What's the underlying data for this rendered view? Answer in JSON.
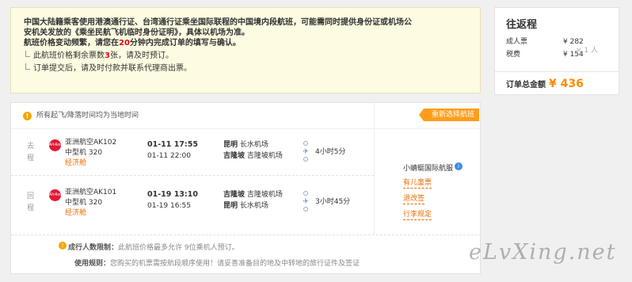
{
  "notice": {
    "line1": "中国大陆籍乘客使用港澳通行证、台湾通行证乘坐国际联程的中国境内段航班，可能需同时提供身份证或机场公",
    "line2": "安机关发放的《乘坐民航飞机临时身份证明》，具体以机场为准。",
    "line3_pre": "航班价格变动频繁，请您在",
    "line3_num": "20",
    "line3_post": "分钟内完成订单的填写与确认。",
    "item1_pre": "此航班价格剩余票数",
    "item1_num": "3",
    "item1_post": "张，请及时预订。",
    "item2": "订单提交后，请及时付款并联系代理商出票。"
  },
  "summary": {
    "title": "往返程",
    "adult_label": "成人票",
    "adult_price": "¥ 282",
    "tax_label": "税费",
    "tax_price": "¥ 154",
    "multiplier": "× 1 人",
    "total_label": "订单总金额",
    "total_price": "¥ 436"
  },
  "flight": {
    "header": "所有起飞/降落时间均为当地时间",
    "legs": [
      {
        "dir": "去程",
        "logo": "AirAsia",
        "airline": "亚洲航空AK102",
        "aircraft": "中型机 320",
        "cabin": "经济舱",
        "dep_time": "01-11 17:55",
        "arr_time": "01-11 22:00",
        "dep_city": "昆明",
        "dep_airport": "长水机场",
        "arr_city": "吉隆坡",
        "arr_airport": "吉隆坡机场",
        "duration": "4小时5分"
      },
      {
        "dir": "回程",
        "logo": "AirAsia",
        "airline": "亚洲航空AK101",
        "aircraft": "中型机 320",
        "cabin": "经济舱",
        "dep_time": "01-19 13:10",
        "arr_time": "01-19 16:55",
        "dep_city": "吉隆坡",
        "dep_airport": "吉隆坡机场",
        "arr_city": "昆明",
        "arr_airport": "长水机场",
        "duration": "3小时45分"
      }
    ],
    "reselect": "重新选择航班",
    "agency": "小蜻蜓国际航服",
    "links": [
      "有儿童票",
      "退改签",
      "行李规定"
    ],
    "rule1_label": "成行人数限制：",
    "rule1_text": "此航班价格最多允许 9位乘机人预订。",
    "rule2_label": "使用规则：",
    "rule2_text": "您购买的机票需按航段顺序使用！请妥善准备目的地及中转地的旅行证件及签证"
  },
  "watermark": "eLvXing.net"
}
